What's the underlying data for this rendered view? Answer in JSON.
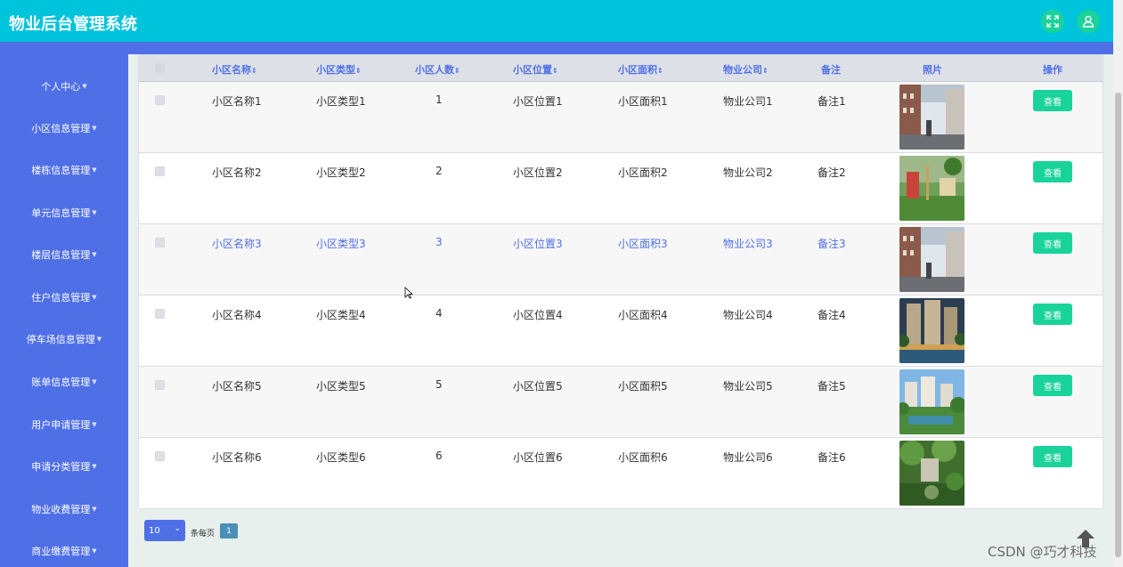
{
  "app": {
    "title": "物业后台管理系统"
  },
  "header": {
    "fullscreen_icon": "expand-icon",
    "user_icon": "user-icon"
  },
  "sidebar": {
    "items": [
      {
        "label": "个人中心"
      },
      {
        "label": "小区信息管理"
      },
      {
        "label": "楼栋信息管理"
      },
      {
        "label": "单元信息管理"
      },
      {
        "label": "楼层信息管理"
      },
      {
        "label": "住户信息管理"
      },
      {
        "label": "停车场信息管理"
      },
      {
        "label": "账单信息管理"
      },
      {
        "label": "用户申请管理"
      },
      {
        "label": "申请分类管理"
      },
      {
        "label": "物业收费管理"
      },
      {
        "label": "商业缴费管理"
      }
    ]
  },
  "table": {
    "columns": {
      "name": "小区名称",
      "type": "小区类型",
      "people": "小区人数",
      "location": "小区位置",
      "area": "小区面积",
      "company": "物业公司",
      "remark": "备注",
      "photo": "照片",
      "action": "操作"
    },
    "sort_icon": "⇕",
    "rows": [
      {
        "name": "小区名称1",
        "type": "小区类型1",
        "people": "1",
        "location": "小区位置1",
        "area": "小区面积1",
        "company": "物业公司1",
        "remark": "备注1",
        "action": "查看"
      },
      {
        "name": "小区名称2",
        "type": "小区类型2",
        "people": "2",
        "location": "小区位置2",
        "area": "小区面积2",
        "company": "物业公司2",
        "remark": "备注2",
        "action": "查看"
      },
      {
        "name": "小区名称3",
        "type": "小区类型3",
        "people": "3",
        "location": "小区位置3",
        "area": "小区面积3",
        "company": "物业公司3",
        "remark": "备注3",
        "action": "查看"
      },
      {
        "name": "小区名称4",
        "type": "小区类型4",
        "people": "4",
        "location": "小区位置4",
        "area": "小区面积4",
        "company": "物业公司4",
        "remark": "备注4",
        "action": "查看"
      },
      {
        "name": "小区名称5",
        "type": "小区类型5",
        "people": "5",
        "location": "小区位置5",
        "area": "小区面积5",
        "company": "物业公司5",
        "remark": "备注5",
        "action": "查看"
      },
      {
        "name": "小区名称6",
        "type": "小区类型6",
        "people": "6",
        "location": "小区位置6",
        "area": "小区面积6",
        "company": "物业公司6",
        "remark": "备注6",
        "action": "查看"
      }
    ]
  },
  "pagination": {
    "page_size": "10",
    "per_page_label": "条每页",
    "current_page": "1"
  },
  "watermark": "CSDN @巧才科技",
  "colors": {
    "header": "#00c3dc",
    "sidebar": "#4f6fe6",
    "button": "#19d39a",
    "link": "#4f6fe6"
  }
}
